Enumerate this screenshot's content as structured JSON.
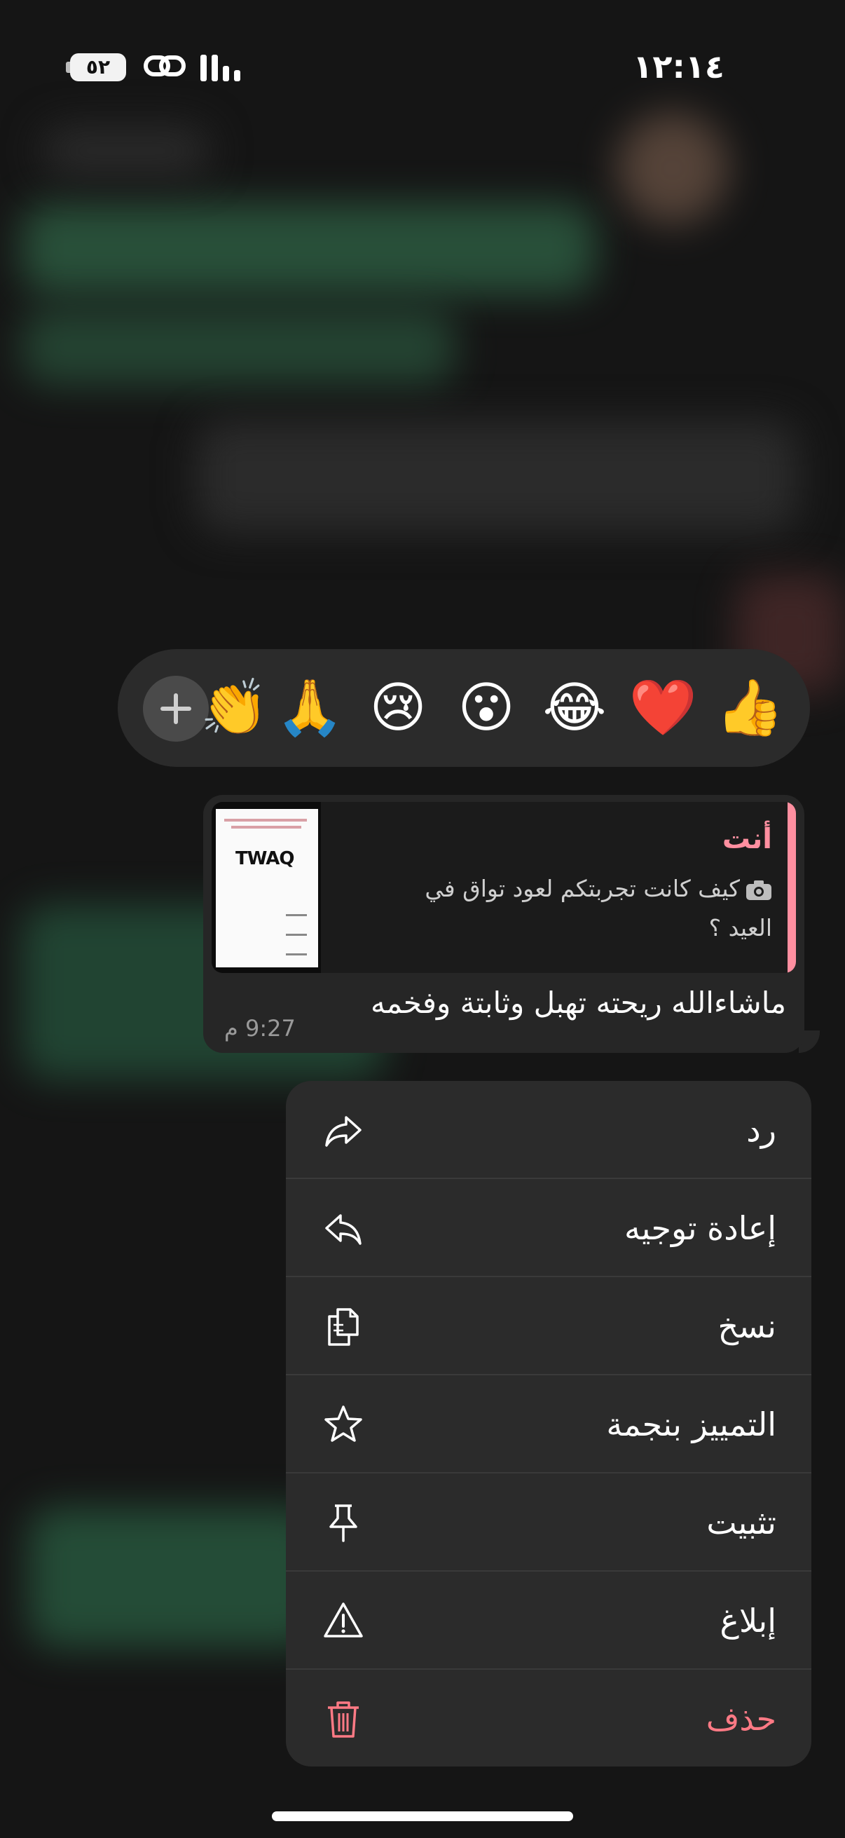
{
  "status_bar": {
    "time": "١٢:١٤",
    "battery": "٥٢"
  },
  "reactions": {
    "items": [
      "👍",
      "❤️",
      "😂",
      "😮",
      "😢",
      "🙏",
      "👏"
    ],
    "add_icon": "plus-icon"
  },
  "message": {
    "quote_sender": "أنت",
    "quote_text": "كيف كانت تجربتكم لعود تواق في العيد ؟",
    "quote_thumb_logo": "TWAQ",
    "text": "ماشاءالله ريحته تهبل وثابتة وفخمه",
    "time": "9:27 م"
  },
  "menu": {
    "items": [
      {
        "label": "رد",
        "icon": "reply-icon"
      },
      {
        "label": "إعادة توجيه",
        "icon": "forward-icon"
      },
      {
        "label": "نسخ",
        "icon": "copy-icon"
      },
      {
        "label": "التمييز بنجمة",
        "icon": "star-icon"
      },
      {
        "label": "تثبيت",
        "icon": "pin-icon"
      },
      {
        "label": "إبلاغ",
        "icon": "warning-icon"
      },
      {
        "label": "حذف",
        "icon": "trash-icon"
      }
    ]
  },
  "colors": {
    "accent_pink": "#ff8fa0",
    "danger": "#ff7a85",
    "menu_bg": "#2b2b2b",
    "bubble_bg": "#262626"
  }
}
